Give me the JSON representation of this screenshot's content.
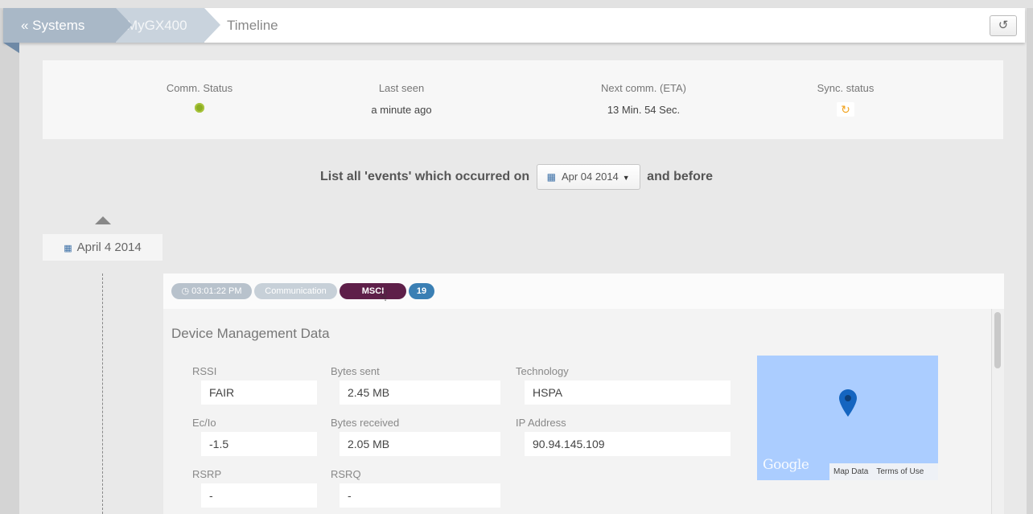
{
  "breadcrumb": {
    "systems": "« Systems",
    "device": "MyGX400",
    "current": "Timeline"
  },
  "header": {
    "refresh_icon": "refresh-icon"
  },
  "status": {
    "comm_label": "Comm. Status",
    "comm_state": "ok",
    "last_seen_label": "Last seen",
    "last_seen_value": "a minute ago",
    "next_comm_label": "Next comm. (ETA)",
    "next_comm_value": "13 Min. 54 Sec.",
    "sync_label": "Sync. status",
    "sync_icon": "sync-icon"
  },
  "filter": {
    "prefix": "List all 'events' which occurred on",
    "date": "Apr 04 2014",
    "suffix": "and before"
  },
  "timeline": {
    "date_label": "April 4 2014"
  },
  "event": {
    "time": "03:01:22 PM",
    "type": "Communication",
    "tag": "MSCI",
    "count": "19",
    "section_title": "Device Management Data",
    "fields": {
      "rssi_label": "RSSI",
      "rssi_value": "FAIR",
      "bytes_sent_label": "Bytes sent",
      "bytes_sent_value": "2.45 MB",
      "technology_label": "Technology",
      "technology_value": "HSPA",
      "ecio_label": "Ec/Io",
      "ecio_value": "-1.5",
      "bytes_received_label": "Bytes received",
      "bytes_received_value": "2.05 MB",
      "ip_label": "IP Address",
      "ip_value": "90.94.145.109",
      "rsrp_label": "RSRP",
      "rsrp_value": "-",
      "rsrq_label": "RSRQ",
      "rsrq_value": "-"
    },
    "map": {
      "logo": "Google",
      "map_data": "Map Data",
      "terms": "Terms of Use"
    }
  },
  "colors": {
    "breadcrumb_active": "#a9b8c7",
    "msci_badge": "#5e1f49",
    "count_badge": "#3a7fb4",
    "status_ok": "#8cae24",
    "sync": "#f1a21c",
    "map_water": "#abcdff",
    "map_pin": "#1565c0"
  }
}
